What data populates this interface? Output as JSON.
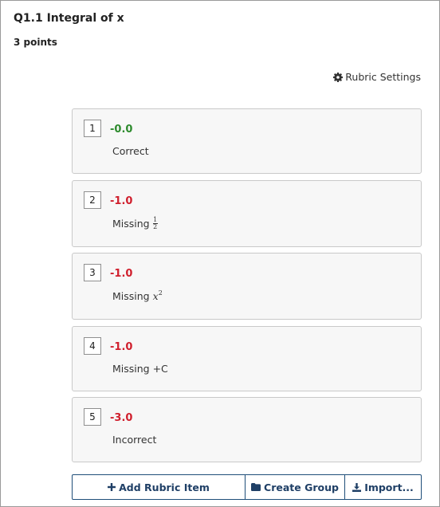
{
  "question": {
    "title": "Q1.1 Integral of x",
    "points": "3 points"
  },
  "settings": {
    "label": "Rubric Settings",
    "icon": "gear-icon"
  },
  "rubric_items": [
    {
      "key": "1",
      "points": "-0.0",
      "status_color": "#2e8b2e",
      "description": "Correct"
    },
    {
      "key": "2",
      "points": "-1.0",
      "status_color": "#d0202e",
      "description": "Missing",
      "math": "1/2"
    },
    {
      "key": "3",
      "points": "-1.0",
      "status_color": "#d0202e",
      "description": "Missing",
      "math": "x^2"
    },
    {
      "key": "4",
      "points": "-1.0",
      "status_color": "#d0202e",
      "description": "Missing +C"
    },
    {
      "key": "5",
      "points": "-3.0",
      "status_color": "#d0202e",
      "description": "Incorrect"
    }
  ],
  "toolbar": {
    "add_label": "Add Rubric Item",
    "group_label": "Create Group",
    "import_label": "Import...",
    "accent": "#1f4e79"
  }
}
